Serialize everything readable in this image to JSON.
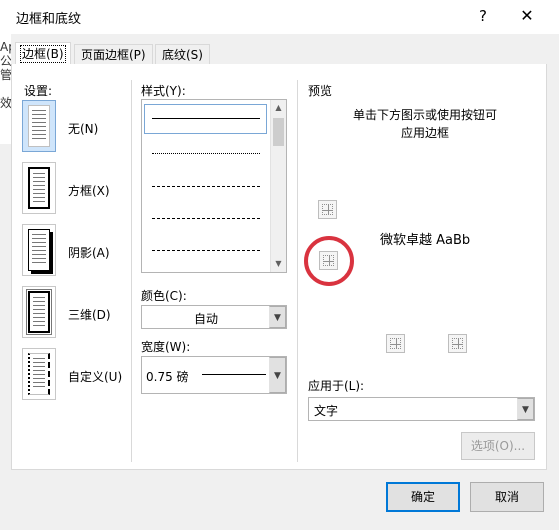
{
  "window": {
    "title": "边框和底纹",
    "help": "?",
    "close": "✕"
  },
  "left_strip_text": [
    "Ap",
    "公",
    "管",
    "",
    "效"
  ],
  "tabs": [
    {
      "label": "边框(B)",
      "active": true
    },
    {
      "label": "页面边框(P)",
      "active": false
    },
    {
      "label": "底纹(S)",
      "active": false
    }
  ],
  "settings": {
    "label": "设置:",
    "items": [
      {
        "label": "无(N)",
        "icon": "setting-none-icon"
      },
      {
        "label": "方框(X)",
        "icon": "setting-box-icon"
      },
      {
        "label": "阴影(A)",
        "icon": "setting-shadow-icon"
      },
      {
        "label": "三维(D)",
        "icon": "setting-3d-icon"
      },
      {
        "label": "自定义(U)",
        "icon": "setting-custom-icon"
      }
    ]
  },
  "style": {
    "label": "样式(Y):"
  },
  "color": {
    "label": "颜色(C):",
    "value": "自动"
  },
  "width": {
    "label": "宽度(W):",
    "value": "0.75 磅"
  },
  "preview": {
    "label": "预览",
    "hint_line1": "单击下方图示或使用按钮可",
    "hint_line2": "应用边框",
    "sample_text": "微软卓越  AaBb"
  },
  "apply_to": {
    "label": "应用于(L):",
    "value": "文字"
  },
  "options_button": "选项(O)...",
  "ok_button": "确定",
  "cancel_button": "取消",
  "colors": {
    "selection_blue": "#cfe5fb",
    "highlight_red": "#d9333f",
    "default_button_border": "#0078d7"
  }
}
